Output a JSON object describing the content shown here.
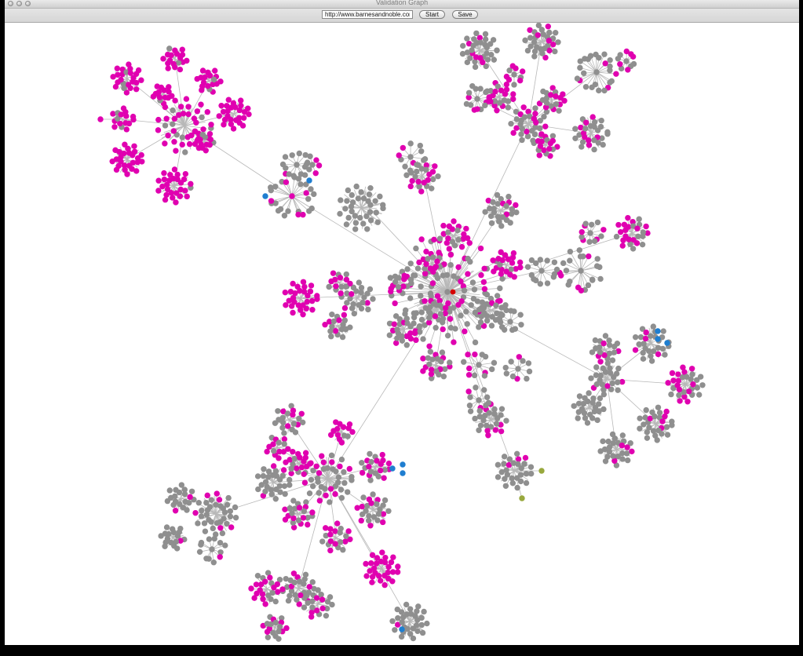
{
  "window": {
    "title": "Validation Graph"
  },
  "toolbar": {
    "url_value": "http://www.barnesandnoble.com/",
    "start_label": "Start",
    "save_label": "Save"
  },
  "graph": {
    "colors": {
      "edge": "#b8b8b8",
      "gray_node": "#8f8f8f",
      "magenta_node": "#e000b0",
      "blue_node": "#1f7ed0",
      "olive_node": "#98a83d",
      "red_node": "#d60000"
    }
  }
}
